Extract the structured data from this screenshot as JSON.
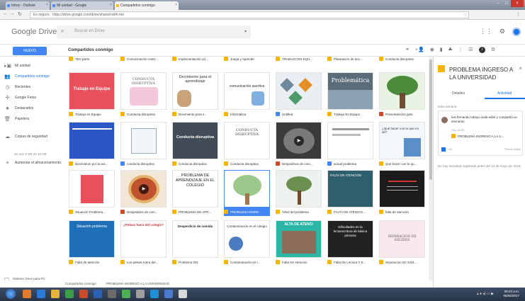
{
  "browser": {
    "tabs": [
      {
        "label": "Inbox - Outlook"
      },
      {
        "label": "Mi unidad - Google"
      },
      {
        "label": "Compartidos conmigo"
      }
    ],
    "url": "https://drive.google.com/drive/shared-with-me",
    "secure_label": "Es seguro"
  },
  "header": {
    "logo_google": "Google",
    "logo_drive": "Drive",
    "search_placeholder": "Buscar en Drive"
  },
  "toolbar": {
    "new_label": "NUEVO",
    "breadcrumb": "Compartidos conmigo"
  },
  "sidebar": {
    "items": [
      {
        "label": "Mi unidad"
      },
      {
        "label": "Compartidos conmigo"
      },
      {
        "label": "Recientes"
      },
      {
        "label": "Google Fotos"
      },
      {
        "label": "Destacados"
      },
      {
        "label": "Papelera"
      },
      {
        "label": "Copias de seguridad"
      }
    ],
    "storage": "Se usó 3 GB de 15 GB",
    "upgrade": "Aumentar el almacenamiento",
    "footer": "Obtener Drive para PC"
  },
  "files": [
    {
      "name": "TEV parts",
      "thumb": ""
    },
    {
      "name": "Comunicación Asert...",
      "thumb": ""
    },
    {
      "name": "Implementación (e)...",
      "thumb": ""
    },
    {
      "name": "Juega y Aprende",
      "thumb": ""
    },
    {
      "name": "TRABAJO EN EQU...",
      "thumb": ""
    },
    {
      "name": "Planeación de doc...",
      "thumb": ""
    },
    {
      "name": "Conducta disruptiva",
      "thumb": ""
    },
    {
      "name": "Trabajo en Equipo",
      "thumb": "Trabajo en Equipo"
    },
    {
      "name": "Conducta disruptiva",
      "thumb": "CONDUCTA DISRUPTIVA"
    },
    {
      "name": "Decimiento para e...",
      "thumb": "Decimiento para el aprendizaje"
    },
    {
      "name": "Informática",
      "thumb": "comunicación asertiva"
    },
    {
      "name": "Untitled",
      "thumb": ""
    },
    {
      "name": "Trabajo En Equipo",
      "thumb": "Problemática"
    },
    {
      "name": "Presentación1.pptx",
      "thumb": ""
    },
    {
      "name": "Decimiento por la act...",
      "thumb": ""
    },
    {
      "name": "conducta disruptiva",
      "thumb": ""
    },
    {
      "name": "Conducta disruptiva",
      "thumb": "Conducta disruptiva"
    },
    {
      "name": "Conducta disruptiva",
      "thumb": "CONDUCTA DISRUPTIVA"
    },
    {
      "name": "Despedinos de com...",
      "thumb": ""
    },
    {
      "name": "actual problema",
      "thumb": ""
    },
    {
      "name": "Qué hacer con lo qu...",
      "thumb": "¿Qué hacer con lo que no sé?"
    },
    {
      "name": "Situación Problema...",
      "thumb": ""
    },
    {
      "name": "Despedidos de com...",
      "thumb": ""
    },
    {
      "name": "PROBLEMA DE APR...",
      "thumb": "PROBLEMA DE APRENDIZAJE EN EL COLEGIO"
    },
    {
      "name": "PROBLEMA INGRE...",
      "thumb": ""
    },
    {
      "name": "Árbol del problema",
      "thumb": ""
    },
    {
      "name": "FALTA DE ATENCIO...",
      "thumb": "FALTA DE ATENCIÓN"
    },
    {
      "name": "falta de atención",
      "thumb": ""
    },
    {
      "name": "Falta de atención",
      "thumb": "Situación problema"
    },
    {
      "name": "Los peleas tuera del...",
      "thumb": "¿Peleas fuera del colegio?"
    },
    {
      "name": "Problema 001",
      "thumb": "Desperdicio de comida"
    },
    {
      "name": "Contaminación en l...",
      "thumb": "Contaminación en el colegio"
    },
    {
      "name": "Falta De Atención",
      "thumb": "ALTA DE ATENCI"
    },
    {
      "name": "Falta De Lectura Y E...",
      "thumb": "Dificultades en la lectoescritura de básica primaria"
    },
    {
      "name": "Separacion De Sóld...",
      "thumb": "SEPARACION DE SOLIDOS"
    }
  ],
  "panel": {
    "title": "PROBLEMA INGRESO A LA UNIVERSIDAD",
    "tab_details": "Detalles",
    "tab_activity": "Actividad",
    "section": "Esta semana",
    "activity_text": "luis fernando robayo avila editó y compartió un elemento",
    "activity_time": "Hoy 10:00",
    "activity_file": "PROBLEMA INGRESO A LA U...",
    "activity_can": "Ve",
    "activity_role": "Puede editar",
    "note": "No hay actividad registrada antes del 13 de mayo de 2016."
  },
  "status": {
    "left": "Compartidos conmigo",
    "file": "PROBLEMA INGRESO A LA UNIVERSIDAD"
  },
  "taskbar": {
    "time": "08:23 a.m.",
    "date": "06/06/2017"
  }
}
